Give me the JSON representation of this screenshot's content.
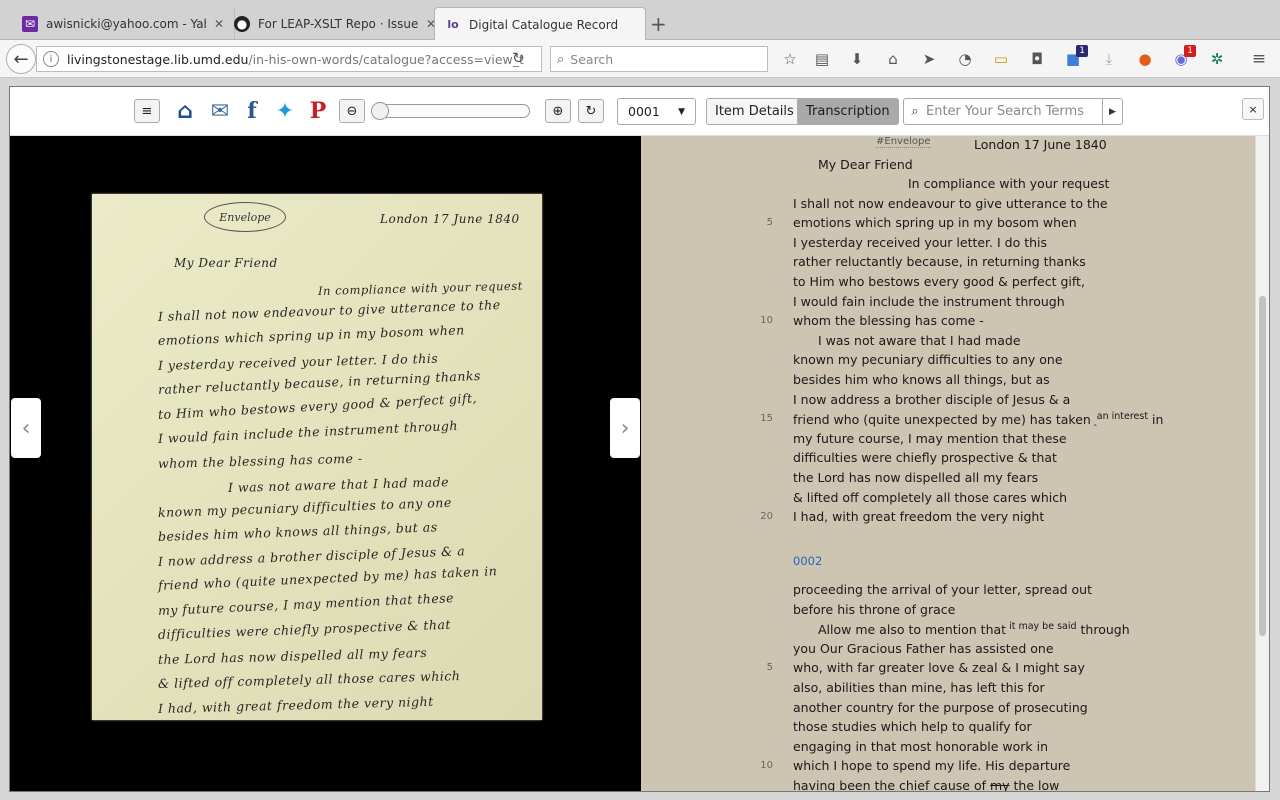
{
  "browser": {
    "tabs": [
      {
        "title": "awisnicki@yahoo.com - Yahoo",
        "icon": "mail-icon"
      },
      {
        "title": "For LEAP-XSLT Repo · Issue #",
        "icon": "github-icon"
      },
      {
        "title": "Digital Catalogue Record | Liv",
        "icon": "lo-icon"
      }
    ],
    "url_host": "livingstonestage.lib.umd.edu",
    "url_path": "/in-his-own-words/catalogue?access=view_t",
    "search_placeholder": "Search",
    "badge_a": "1",
    "badge_b": "1"
  },
  "toolbar": {
    "page_number": "0001",
    "item_details_label": "Item Details",
    "transcription_label": "Transcription",
    "search_placeholder": "Enter Your Search Terms",
    "close_label": "×"
  },
  "manuscript": {
    "envelope_label": "Envelope",
    "date_line": "London 17 June 1840",
    "salutation": "My Dear Friend",
    "lines": [
      "In compliance with your request",
      "I shall not now endeavour to give utterance to the",
      "emotions which spring up in my bosom when",
      "I yesterday received your letter. I do this",
      "rather reluctantly because, in returning thanks",
      "to Him who bestows every good & perfect gift,",
      "I would fain include the instrument through",
      "whom the blessing has come -",
      "I was not aware that I had made",
      "known my pecuniary difficulties to any one",
      "besides him who knows all things, but as",
      "I now address a brother disciple of Jesus & a",
      "friend who (quite unexpected by me) has taken in",
      "my future course, I may mention that these",
      "difficulties were chiefly prospective & that",
      "the Lord has now dispelled all my fears",
      "& lifted off completely all those cares which",
      "I had, with great freedom the very night"
    ]
  },
  "transcription": {
    "envelope_tag": "#Envelope",
    "date": "London 17 June 1840",
    "salutation": "My Dear Friend",
    "page1": [
      {
        "text": "In compliance with your request",
        "num": ""
      },
      {
        "text": "I shall not now endeavour to give utterance to the",
        "num": ""
      },
      {
        "text": "emotions which spring up in my bosom when",
        "num": "5"
      },
      {
        "text": "I yesterday received your letter. I do this",
        "num": ""
      },
      {
        "text": "rather reluctantly because, in returning thanks",
        "num": ""
      },
      {
        "text": "to Him who bestows every good & perfect gift,",
        "num": ""
      },
      {
        "text": "I would fain include the instrument through",
        "num": ""
      },
      {
        "text": "whom the blessing has come -",
        "num": "10"
      },
      {
        "text": "I was not aware that I had made",
        "num": ""
      },
      {
        "text": "known my pecuniary difficulties to any one",
        "num": ""
      },
      {
        "text": "besides him who knows all things, but as",
        "num": ""
      },
      {
        "text": "I now address a brother disciple of Jesus & a",
        "num": ""
      },
      {
        "text": "friend who (quite unexpected by me) has taken",
        "num": "15"
      },
      {
        "text": "my future course, I may mention that these",
        "num": ""
      },
      {
        "text": "difficulties were chiefly prospective & that",
        "num": ""
      },
      {
        "text": "the Lord has now dispelled all my fears",
        "num": ""
      },
      {
        "text": "& lifted off completely all those cares which",
        "num": ""
      },
      {
        "text": "I had, with great freedom the very night",
        "num": "20"
      }
    ],
    "line15_sup": "an interest",
    "line15_tail": "in",
    "page2_label": "0002",
    "page2": [
      {
        "text": "proceeding the arrival of your letter, spread out",
        "num": ""
      },
      {
        "text": "before his throne of grace",
        "num": ""
      },
      {
        "text": "Allow me also to mention that",
        "num": ""
      },
      {
        "text": "you Our Gracious Father has assisted one",
        "num": ""
      },
      {
        "text": "who, with far greater love & zeal & I might say",
        "num": "5"
      },
      {
        "text": "also, abilities than mine, has left this for",
        "num": ""
      },
      {
        "text": "another country for the purpose of prosecuting",
        "num": ""
      },
      {
        "text": "those studies which help to qualify for",
        "num": ""
      },
      {
        "text": "engaging in that most honorable work in",
        "num": ""
      },
      {
        "text": "which I hope to spend my life. His departure",
        "num": "10"
      },
      {
        "text": "having been the chief cause of",
        "num": ""
      }
    ],
    "p2_sup": "it may be said",
    "p2_through": "through",
    "p2_strike": "my",
    "p2_tail": "the low"
  }
}
